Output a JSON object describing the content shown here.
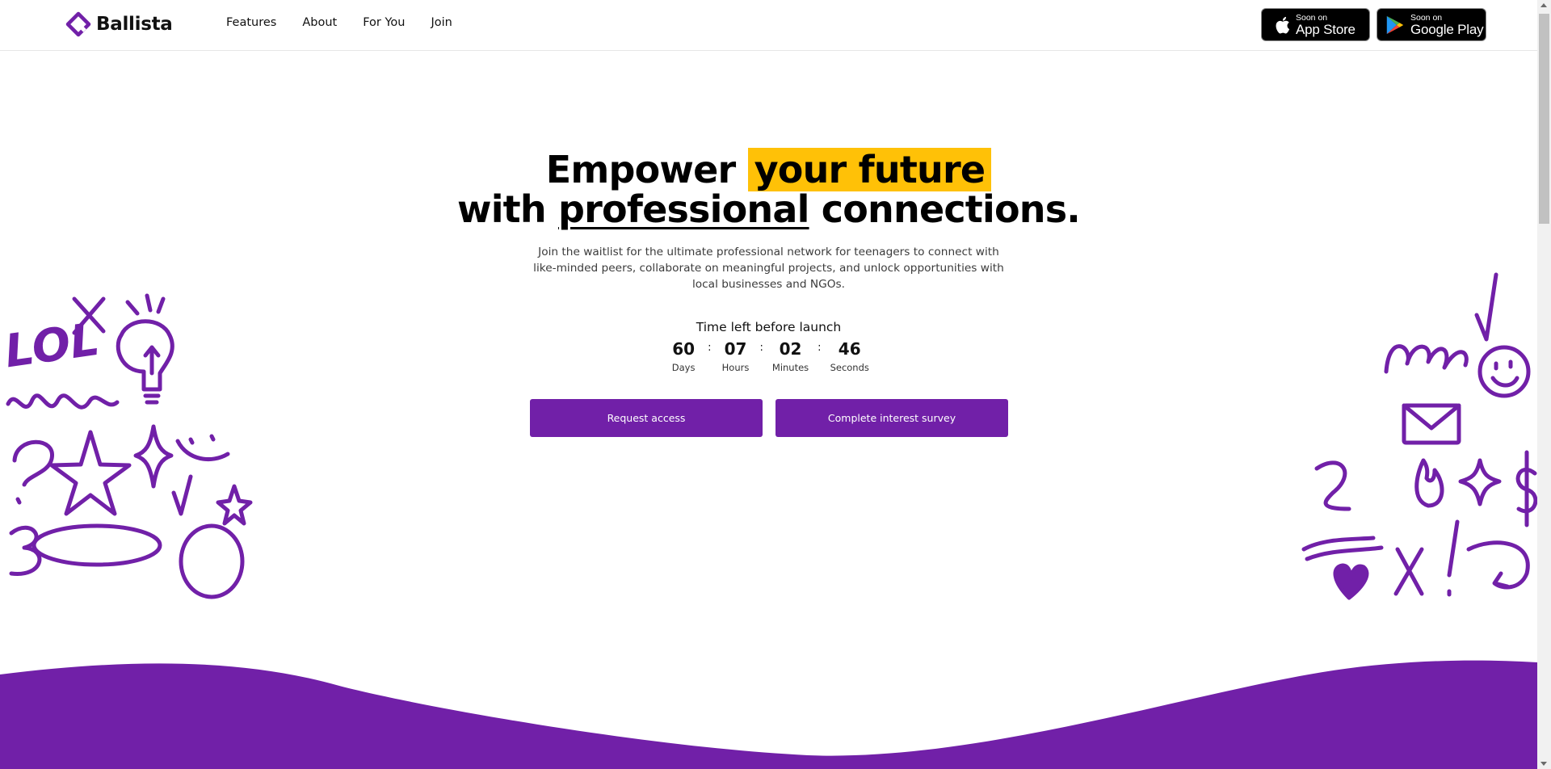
{
  "nav": {
    "brand": "Ballista",
    "links": [
      "Features",
      "About",
      "For You",
      "Join"
    ],
    "app_store": {
      "small": "Soon on",
      "big": "App Store"
    },
    "google_play": {
      "small": "Soon on",
      "big": "Google Play"
    }
  },
  "hero": {
    "headline_1a": "Empower ",
    "headline_1b": "your future",
    "headline_2a": "with ",
    "headline_2b": "professional",
    "headline_2c": " connections.",
    "subtext": "Join the waitlist for the ultimate professional network for teenagers to connect with like-minded peers, collaborate on meaningful projects, and unlock opportunities with local businesses and NGOs."
  },
  "countdown": {
    "title": "Time left before launch",
    "units": [
      {
        "value": "60",
        "label": "Days"
      },
      {
        "value": "07",
        "label": "Hours"
      },
      {
        "value": "02",
        "label": "Minutes"
      },
      {
        "value": "46",
        "label": "Seconds"
      }
    ],
    "separator": ":"
  },
  "cta": {
    "request_access": "Request access",
    "survey": "Complete interest survey"
  },
  "doodles": {
    "left_text": "LOL"
  },
  "colors": {
    "brand_purple": "#7120a8",
    "highlight_yellow": "#ffc107"
  }
}
